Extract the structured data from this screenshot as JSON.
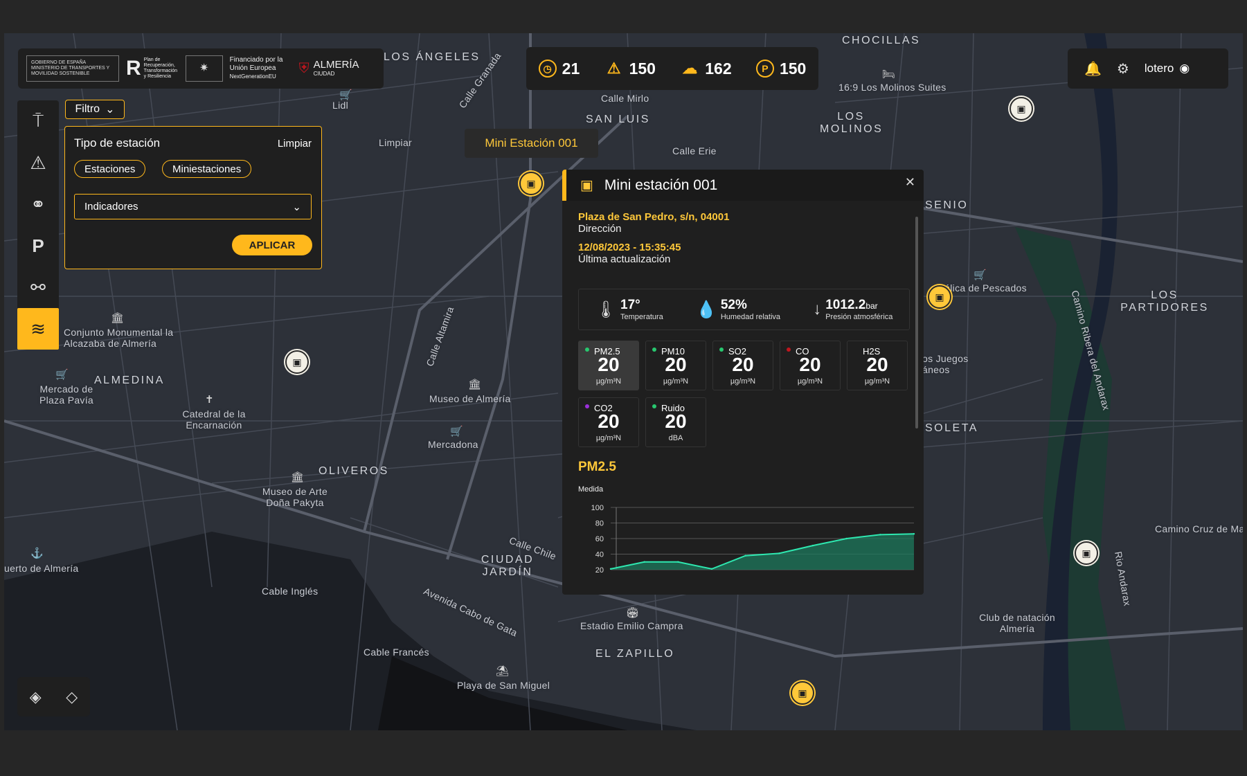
{
  "header": {
    "logos": [
      {
        "text": "GOBIERNO DE ESPAÑA  MINISTERIO DE TRANSPORTES Y MOVILIDAD SOSTENIBLE"
      },
      {
        "text": "Plan de Recuperación, Transformación y Resiliencia"
      },
      {
        "text": "Financiado por la Unión Europea"
      },
      {
        "text": "NextGenerationEU"
      },
      {
        "text": "ALMERÍA"
      },
      {
        "text": "CIUDAD"
      }
    ]
  },
  "stats": [
    {
      "icon": "speedometer-icon",
      "value": "21"
    },
    {
      "icon": "warning-icon",
      "value": "150"
    },
    {
      "icon": "so2-cloud-icon",
      "value": "162"
    },
    {
      "icon": "parking-icon",
      "value": "150"
    }
  ],
  "user": {
    "name": "lotero"
  },
  "filter": {
    "button": "Filtro",
    "title": "Tipo de estación",
    "clear": "Limpiar",
    "chips": [
      "Estaciones",
      "Miniestaciones"
    ],
    "select_value": "Indicadores",
    "apply": "APLICAR"
  },
  "tooltip": "Mini Estación 001",
  "station": {
    "title": "Mini estación 001",
    "address": "Plaza de San Pedro, s/n, 04001",
    "address_label": "Dirección",
    "datetime": "12/08/2023 - 15:35:45",
    "datetime_label": "Última actualización",
    "weather": [
      {
        "value": "17°",
        "unit": "",
        "label": "Temperatura"
      },
      {
        "value": "52%",
        "unit": "",
        "label": "Humedad relativa"
      },
      {
        "value": "1012.2",
        "unit": "bar",
        "label": "Presión atmosférica"
      }
    ],
    "indicators": [
      {
        "name": "PM2.5",
        "value": "20",
        "unit": "µg/m³N",
        "color": "#28c76f"
      },
      {
        "name": "PM10",
        "value": "20",
        "unit": "µg/m³N",
        "color": "#28c76f"
      },
      {
        "name": "SO2",
        "value": "20",
        "unit": "µg/m³N",
        "color": "#28c76f"
      },
      {
        "name": "CO",
        "value": "20",
        "unit": "µg/m³N",
        "color": "#c0161e"
      },
      {
        "name": "H2S",
        "value": "20",
        "unit": "µg/m³N",
        "color": "none"
      },
      {
        "name": "CO2",
        "value": "20",
        "unit": "µg/m³N",
        "color": "#9b30d9"
      },
      {
        "name": "Ruido",
        "value": "20",
        "unit": "dBA",
        "color": "#28c76f"
      }
    ],
    "chart_title": "PM2.5",
    "chart_label": "Medida"
  },
  "chart_data": {
    "type": "area",
    "title": "PM2.5",
    "ylabel": "Medida",
    "yticks": [
      "100",
      "80",
      "60",
      "40",
      "20"
    ],
    "ylim": [
      20,
      100
    ],
    "x": [
      0,
      1,
      2,
      3,
      4,
      5,
      6,
      7,
      8,
      9
    ],
    "series": [
      {
        "values": [
          21,
          30,
          30,
          21,
          38,
          41,
          51,
          60,
          65,
          66
        ]
      }
    ],
    "color": "#2ee8b0"
  },
  "map_labels": [
    "LOS ÁNGELES",
    "CHOCILLAS",
    "SAN LUIS",
    "LOS MOLINOS",
    "16:9 Los Molinos Suites",
    "Lidl",
    "Limpiar",
    "Calle Mirlo",
    "Calle Erie",
    "SENIO",
    "LOS PARTIDORES",
    "Conjunto Monumental la Alcazaba de Almería",
    "ALMEDINA",
    "Mercado de Plaza Pavía",
    "Catedral de la Encarnación",
    "Museo de Almería",
    "Mercadona",
    "OLIVEROS",
    "Museo de Arte Doña Pakyta",
    "CIUDAD JARDÍN",
    "Avenida Cabo de Gata",
    "uerto de Almería",
    "Cable Inglés",
    "Cable Francés",
    "Playa de San Miguel",
    "Estadio Emilio Campra",
    "EL ZAPILLO",
    "Club de natación Almería",
    "SOLETA",
    "Camino Cruz de Ma",
    "Rio Andarax",
    "Camino Ribera del Andarax",
    "tálica de Pescados",
    "os Juegos áneos",
    "Calle Chile",
    "Calle Altamira",
    "Calle Granada"
  ]
}
